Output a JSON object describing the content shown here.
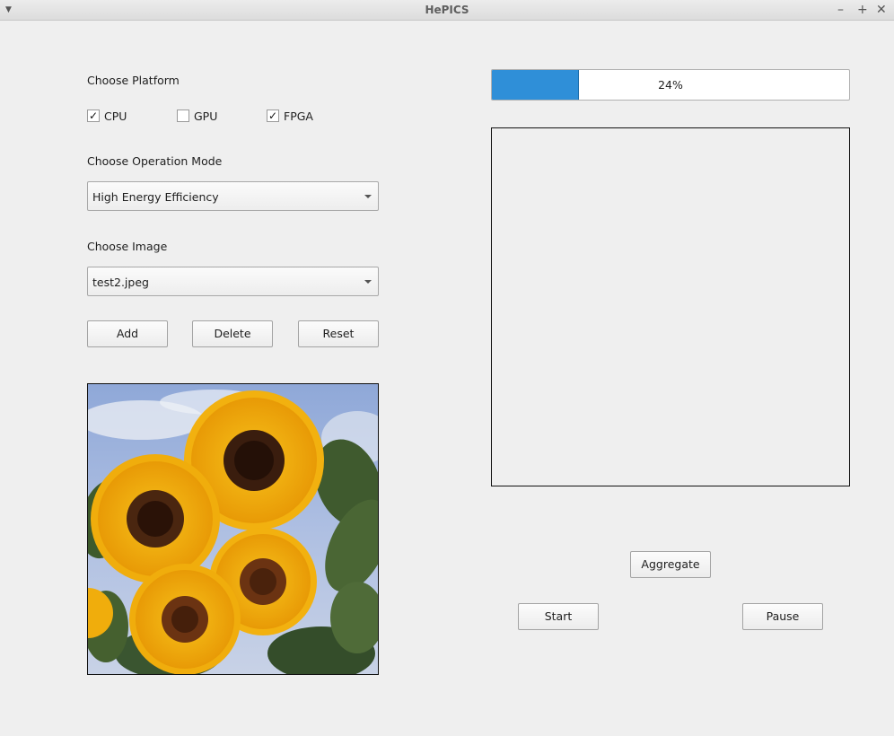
{
  "window": {
    "title": "HePICS",
    "menu_icon": "chevron-down-icon",
    "controls": [
      "minimize-icon",
      "maximize-icon",
      "close-icon"
    ]
  },
  "platform": {
    "label": "Choose Platform",
    "options": [
      {
        "label": "CPU",
        "checked": true
      },
      {
        "label": "GPU",
        "checked": false
      },
      {
        "label": "FPGA",
        "checked": true
      }
    ]
  },
  "mode": {
    "label": "Choose Operation Mode",
    "selected": "High Energy Efficiency"
  },
  "image": {
    "label": "Choose Image",
    "selected": "test2.jpeg"
  },
  "buttons": {
    "add": "Add",
    "delete": "Delete",
    "reset": "Reset",
    "aggregate": "Aggregate",
    "start": "Start",
    "pause": "Pause"
  },
  "progress": {
    "value": 24,
    "text": "24%"
  },
  "colors": {
    "progress_fill": "#2f8fd8",
    "background": "#efefef"
  }
}
